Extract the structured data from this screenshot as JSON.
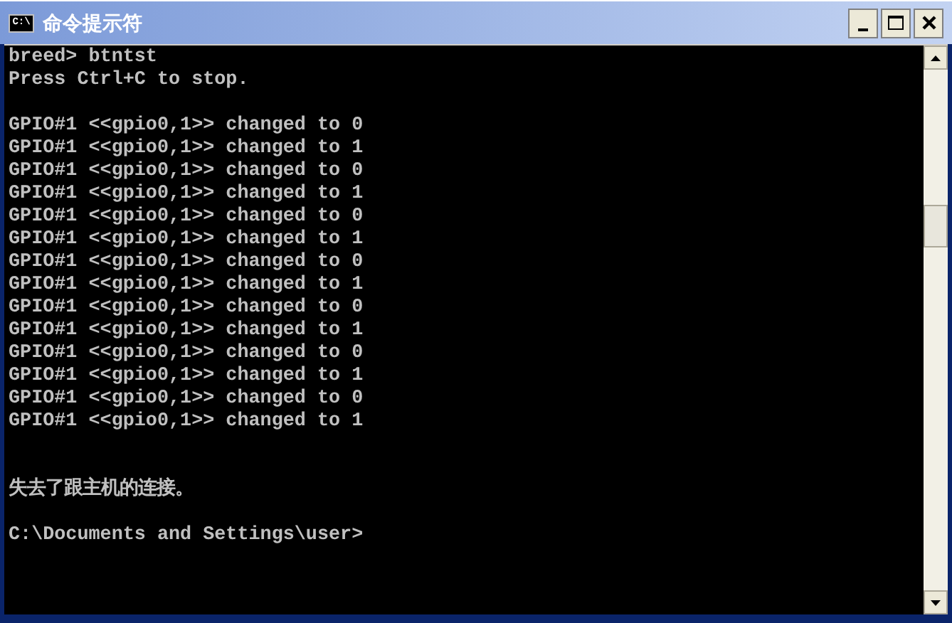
{
  "window": {
    "title": "命令提示符",
    "icon_text": "C:\\"
  },
  "console": {
    "lines": [
      {
        "kind": "text",
        "text": "breed> btntst"
      },
      {
        "kind": "text",
        "text": "Press Ctrl+C to stop."
      },
      {
        "kind": "blank"
      },
      {
        "kind": "text",
        "text": "GPIO#1 <<gpio0,1>> changed to 0"
      },
      {
        "kind": "text",
        "text": "GPIO#1 <<gpio0,1>> changed to 1"
      },
      {
        "kind": "text",
        "text": "GPIO#1 <<gpio0,1>> changed to 0"
      },
      {
        "kind": "text",
        "text": "GPIO#1 <<gpio0,1>> changed to 1"
      },
      {
        "kind": "text",
        "text": "GPIO#1 <<gpio0,1>> changed to 0"
      },
      {
        "kind": "text",
        "text": "GPIO#1 <<gpio0,1>> changed to 1"
      },
      {
        "kind": "text",
        "text": "GPIO#1 <<gpio0,1>> changed to 0"
      },
      {
        "kind": "text",
        "text": "GPIO#1 <<gpio0,1>> changed to 1"
      },
      {
        "kind": "text",
        "text": "GPIO#1 <<gpio0,1>> changed to 0"
      },
      {
        "kind": "text",
        "text": "GPIO#1 <<gpio0,1>> changed to 1"
      },
      {
        "kind": "text",
        "text": "GPIO#1 <<gpio0,1>> changed to 0"
      },
      {
        "kind": "text",
        "text": "GPIO#1 <<gpio0,1>> changed to 1"
      },
      {
        "kind": "text",
        "text": "GPIO#1 <<gpio0,1>> changed to 0"
      },
      {
        "kind": "text",
        "text": "GPIO#1 <<gpio0,1>> changed to 1"
      },
      {
        "kind": "blank"
      },
      {
        "kind": "blank"
      },
      {
        "kind": "text",
        "text": "失去了跟主机的连接。"
      },
      {
        "kind": "blank"
      },
      {
        "kind": "text",
        "text": "C:\\Documents and Settings\\user>"
      }
    ]
  }
}
